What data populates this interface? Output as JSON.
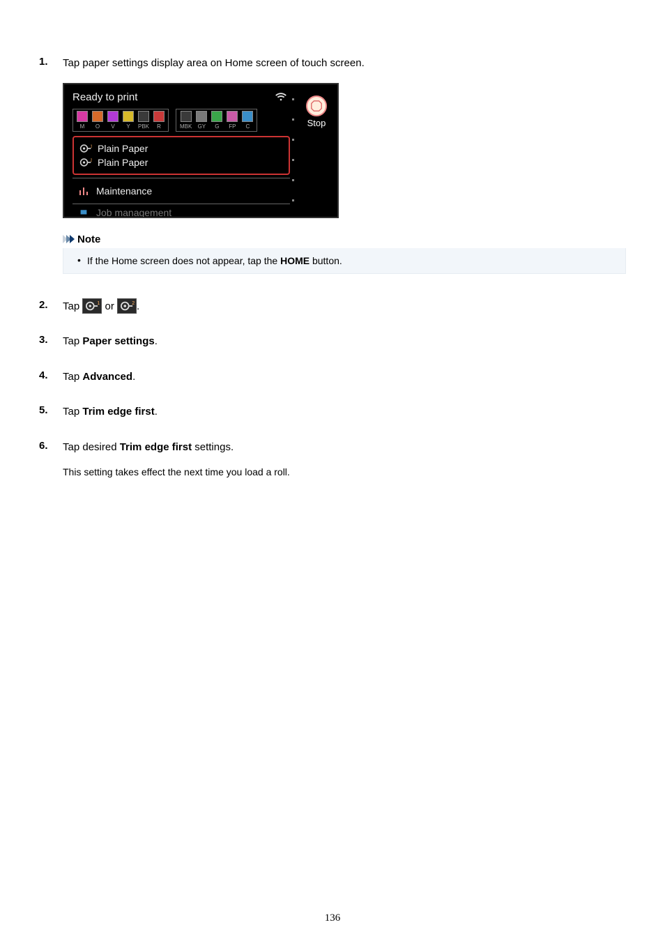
{
  "steps": {
    "s1": {
      "num": "1.",
      "text": "Tap paper settings display area on Home screen of touch screen."
    },
    "s2": {
      "num": "2.",
      "pre": "Tap ",
      "mid": " or ",
      "post": "."
    },
    "s3": {
      "num": "3.",
      "pre": "Tap ",
      "bold": "Paper settings",
      "post": "."
    },
    "s4": {
      "num": "4.",
      "pre": "Tap ",
      "bold": "Advanced",
      "post": "."
    },
    "s5": {
      "num": "5.",
      "pre": "Tap ",
      "bold": "Trim edge first",
      "post": "."
    },
    "s6": {
      "num": "6.",
      "pre": "Tap desired ",
      "bold": "Trim edge first",
      "post": " settings.",
      "body": "This setting takes effect the next time you load a roll."
    }
  },
  "note": {
    "title": "Note",
    "body_pre": "If the Home screen does not appear, tap the ",
    "body_bold": "HOME",
    "body_post": " button."
  },
  "screenshot": {
    "status": "Ready to print",
    "stop": "Stop",
    "inks": {
      "group1": [
        {
          "label": "M",
          "color": "#d63aa3"
        },
        {
          "label": "O",
          "color": "#d66a2a"
        },
        {
          "label": "V",
          "color": "#b23ad6"
        },
        {
          "label": "Y",
          "color": "#d6b92a"
        },
        {
          "label": "PBK",
          "color": "#3a3a3a"
        },
        {
          "label": "R",
          "color": "#c83a3a"
        }
      ],
      "group2": [
        {
          "label": "MBK",
          "color": "#3a3a3a"
        },
        {
          "label": "GY",
          "color": "#7a7a7a"
        },
        {
          "label": "G",
          "color": "#3aa64a"
        },
        {
          "label": "FP",
          "color": "#c85aa6"
        },
        {
          "label": "C",
          "color": "#3a8ec8"
        }
      ]
    },
    "paper1": "Plain Paper",
    "paper2": "Plain Paper",
    "maintenance": "Maintenance",
    "job": "Job management"
  },
  "page_number": "136",
  "icons": {
    "roll1_sup": "1",
    "roll2_sup": "2",
    "chev_colors": [
      "#c9d2dc",
      "#6a89a8",
      "#103a6e"
    ]
  }
}
